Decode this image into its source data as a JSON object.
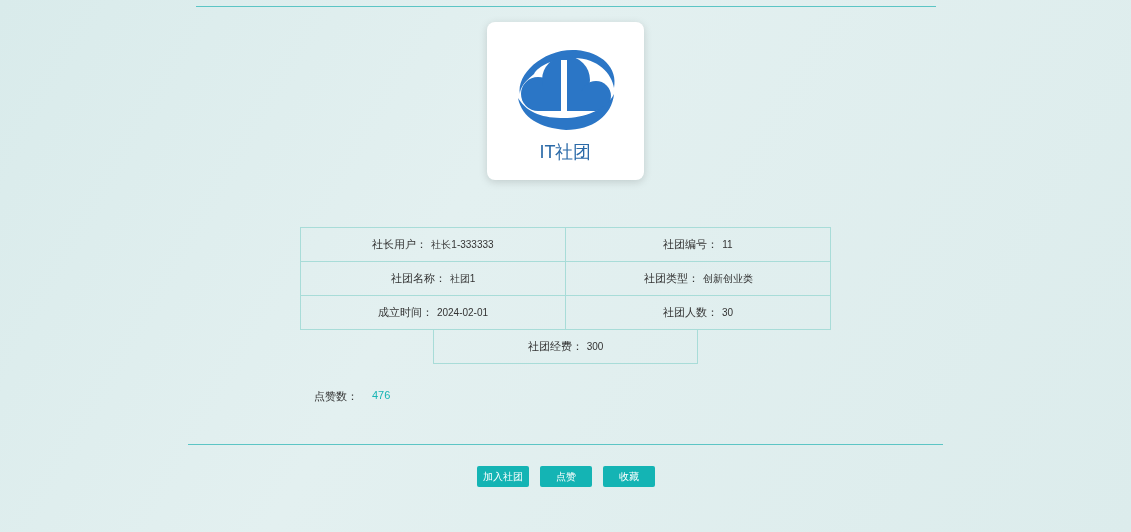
{
  "logo": {
    "text": "IT社团"
  },
  "details": [
    {
      "label": "社长用户：",
      "value": "社长1-333333"
    },
    {
      "label": "社团编号：",
      "value": "11"
    },
    {
      "label": "社团名称：",
      "value": "社团1"
    },
    {
      "label": "社团类型：",
      "value": "创新创业类"
    },
    {
      "label": "成立时间：",
      "value": "2024-02-01"
    },
    {
      "label": "社团人数：",
      "value": "30"
    },
    {
      "label": "社团经费：",
      "value": "300"
    }
  ],
  "likes": {
    "label": "点赞数：",
    "value": "476"
  },
  "buttons": [
    "加入社团",
    "点赞",
    "收藏"
  ]
}
